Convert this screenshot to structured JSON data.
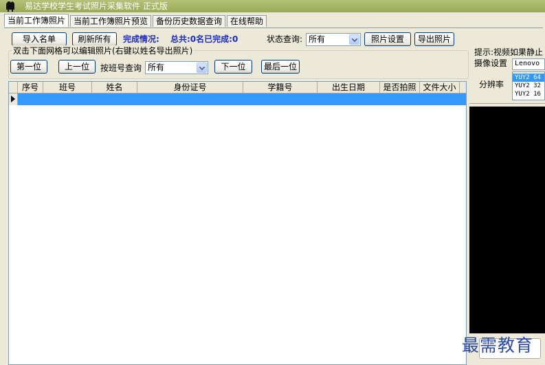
{
  "window": {
    "title": "易达学校学生考试照片采集软件 正式版",
    "app_icon": "camera-icon"
  },
  "tabs": [
    {
      "label": "当前工作簿照片",
      "active": true
    },
    {
      "label": "当前工作簿照片预览",
      "active": false
    },
    {
      "label": "备份历史数据查询",
      "active": false
    },
    {
      "label": "在线帮助",
      "active": false
    }
  ],
  "toolbar": {
    "import_label": "导入名单",
    "refresh_label": "刷新所有",
    "completion_label": "完成情况:",
    "completion_value": "总共:0名已完成:0",
    "status_query_label": "状态查询:",
    "status_query_value": "所有",
    "photo_settings_label": "照片设置",
    "export_photos_label": "导出照片"
  },
  "navigation": {
    "group_title": "双击下面网格可以编辑照片(右键以姓名导出照片)",
    "first_label": "第一位",
    "prev_label": "上一位",
    "class_query_label": "按班号查询",
    "class_query_value": "所有",
    "next_label": "下一位",
    "last_label": "最后一位"
  },
  "grid": {
    "columns": [
      "序号",
      "班号",
      "姓名",
      "身份证号",
      "学籍号",
      "出生日期",
      "是否拍照",
      "文件大小"
    ],
    "rows": [],
    "selection_color": "#3399ff"
  },
  "right_panel": {
    "tip": "提示:视频如果静止",
    "camera_label": "摄像设置",
    "camera_value": "Lenovo",
    "resolution_label": "分辨率",
    "resolutions": [
      "YUY2 64",
      "YUY2 32",
      "YUY2 16"
    ],
    "selected_resolution": 0
  },
  "watermark": {
    "text": "最需教育"
  },
  "colors": {
    "window_bg": "#ece9d8",
    "accent_text": "#1e2cc4",
    "title_bar": "#99aa55"
  }
}
